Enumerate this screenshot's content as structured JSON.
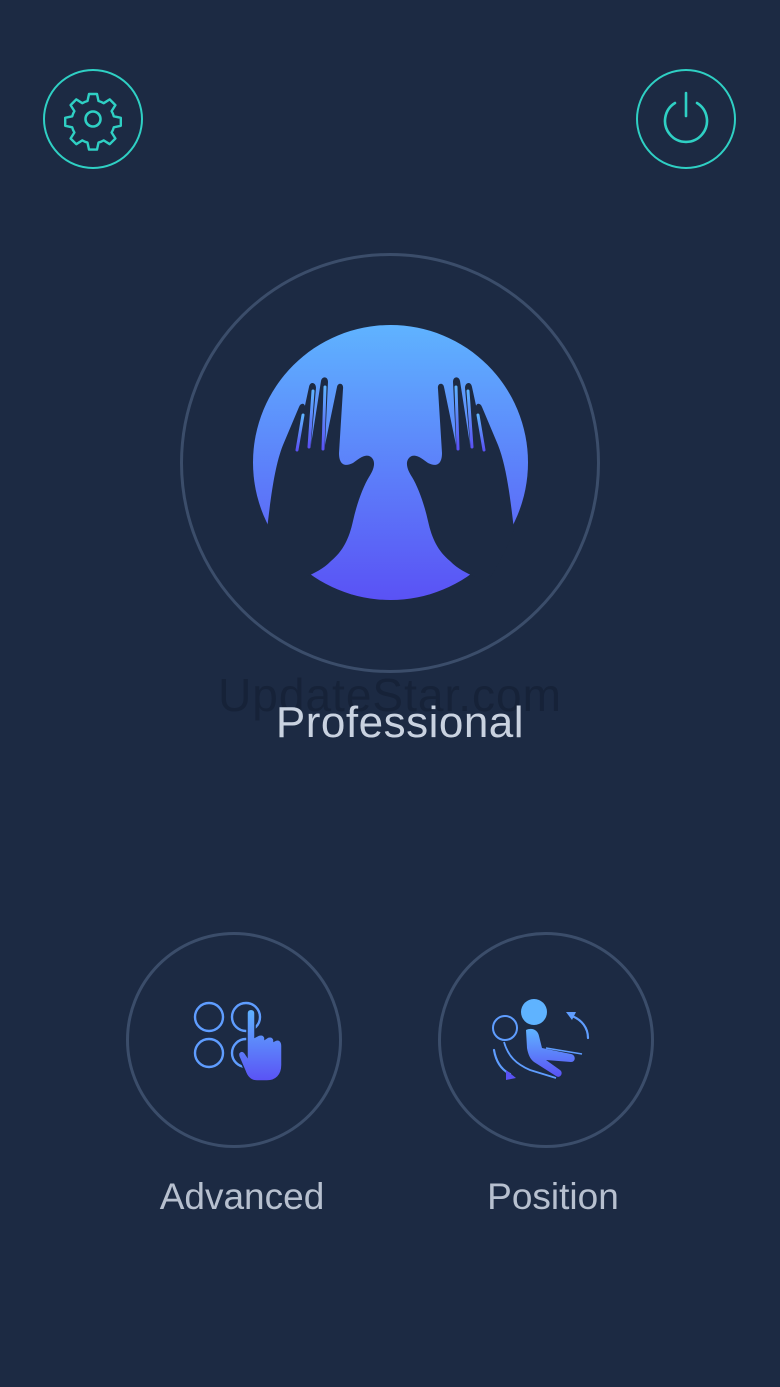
{
  "header": {
    "settings_icon": "gear-icon",
    "power_icon": "power-icon"
  },
  "main_mode": {
    "label": "Professional",
    "icon": "massage-hands-icon"
  },
  "watermark": "UpdateStar.com",
  "modes": [
    {
      "label": "Advanced",
      "icon": "grid-touch-icon"
    },
    {
      "label": "Position",
      "icon": "recline-chair-icon"
    }
  ],
  "colors": {
    "background": "#1c2a43",
    "accent_teal": "#2fd0c4",
    "ring": "#3b4d6a",
    "gradient_top": "#5fb3ff",
    "gradient_bottom": "#5a52f5",
    "label_text": "#c9d2e0"
  }
}
